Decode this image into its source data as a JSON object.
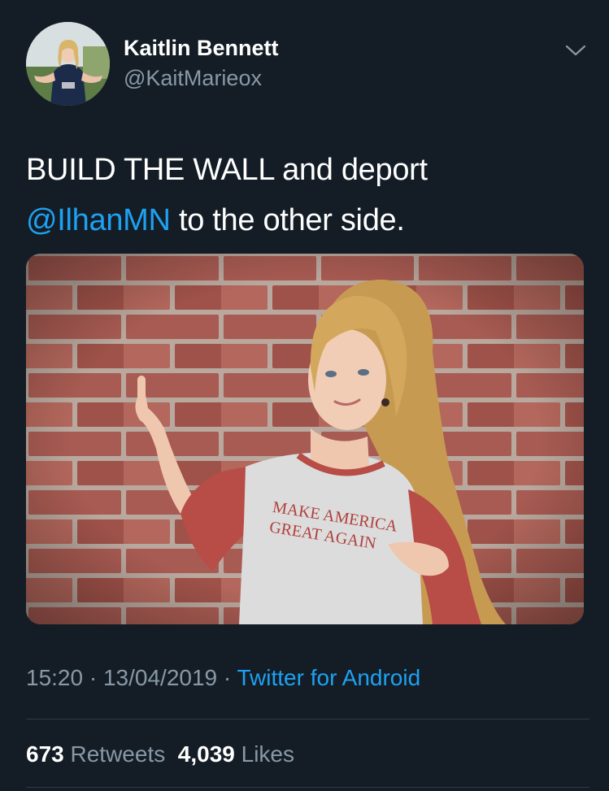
{
  "author": {
    "name": "Kaitlin Bennett",
    "handle": "@KaitMarieox"
  },
  "tweet": {
    "text_before_mention": "BUILD THE WALL and deport",
    "mention": "@IlhanMN",
    "text_after_mention": " to the other side."
  },
  "image": {
    "shirt_text_line1": "MAKE AMERICA",
    "shirt_text_line2": "GREAT AGAIN"
  },
  "meta": {
    "time": "15:20",
    "separator": " · ",
    "date": "13/04/2019",
    "source": "Twitter for Android"
  },
  "stats": {
    "retweets_count": "673",
    "retweets_label": "Retweets",
    "likes_count": "4,039",
    "likes_label": "Likes"
  },
  "icons": {
    "more": "chevron-down-icon"
  },
  "colors": {
    "background": "#141d26",
    "accent": "#1da1f2",
    "secondary_text": "#8899a6",
    "divider": "#2f3b47"
  }
}
